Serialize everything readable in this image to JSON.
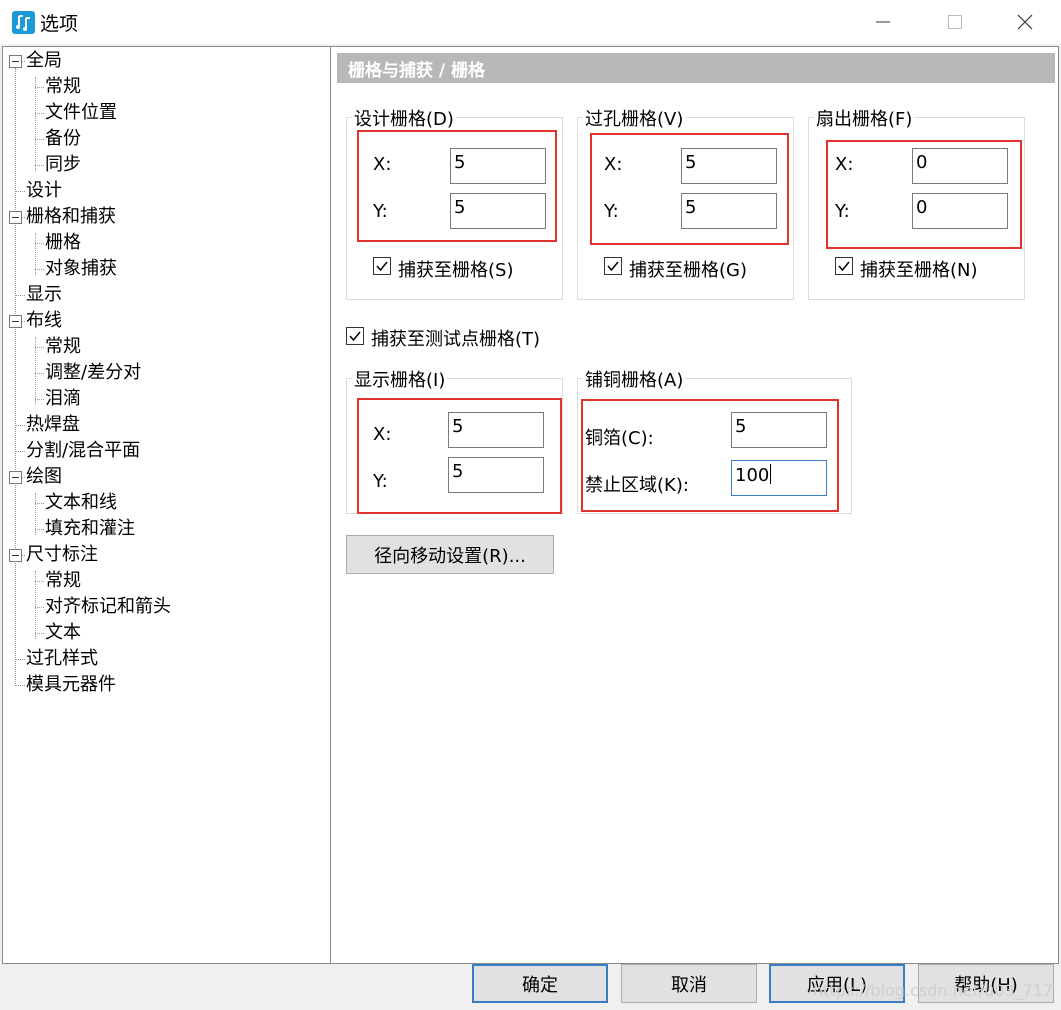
{
  "window": {
    "title": "选项",
    "app_icon": "app-logo-icon",
    "min_icon": "minimize-icon",
    "max_icon": "maximize-icon",
    "close_icon": "close-icon"
  },
  "tree": {
    "items": [
      {
        "label": "全局",
        "level": 0,
        "expanded": true
      },
      {
        "label": "常规",
        "level": 1
      },
      {
        "label": "文件位置",
        "level": 1
      },
      {
        "label": "备份",
        "level": 1
      },
      {
        "label": "同步",
        "level": 1
      },
      {
        "label": "设计",
        "level": 0
      },
      {
        "label": "栅格和捕获",
        "level": 0,
        "expanded": true
      },
      {
        "label": "栅格",
        "level": 1,
        "selected": true
      },
      {
        "label": "对象捕获",
        "level": 1
      },
      {
        "label": "显示",
        "level": 0
      },
      {
        "label": "布线",
        "level": 0,
        "expanded": true
      },
      {
        "label": "常规",
        "level": 1
      },
      {
        "label": "调整/差分对",
        "level": 1
      },
      {
        "label": "泪滴",
        "level": 1
      },
      {
        "label": "热焊盘",
        "level": 0
      },
      {
        "label": "分割/混合平面",
        "level": 0
      },
      {
        "label": "绘图",
        "level": 0,
        "expanded": true
      },
      {
        "label": "文本和线",
        "level": 1
      },
      {
        "label": "填充和灌注",
        "level": 1
      },
      {
        "label": "尺寸标注",
        "level": 0,
        "expanded": true
      },
      {
        "label": "常规",
        "level": 1
      },
      {
        "label": "对齐标记和箭头",
        "level": 1
      },
      {
        "label": "文本",
        "level": 1
      },
      {
        "label": "过孔样式",
        "level": 0
      },
      {
        "label": "模具元器件",
        "level": 0
      }
    ]
  },
  "panel": {
    "header": "栅格与捕获 / 栅格",
    "design_grid": {
      "title": "设计栅格(D)",
      "x_label": "X:",
      "x_value": "5",
      "y_label": "Y:",
      "y_value": "5",
      "snap_label": "捕获至栅格(S)",
      "snap_checked": true
    },
    "via_grid": {
      "title": "过孔栅格(V)",
      "x_label": "X:",
      "x_value": "5",
      "y_label": "Y:",
      "y_value": "5",
      "snap_label": "捕获至栅格(G)",
      "snap_checked": true
    },
    "fanout_grid": {
      "title": "扇出栅格(F)",
      "x_label": "X:",
      "x_value": "0",
      "y_label": "Y:",
      "y_value": "0",
      "snap_label": "捕获至栅格(N)",
      "snap_checked": true
    },
    "snap_testpoint": {
      "label": "捕获至测试点栅格(T)",
      "checked": true
    },
    "display_grid": {
      "title": "显示栅格(I)",
      "x_label": "X:",
      "x_value": "5",
      "y_label": "Y:",
      "y_value": "5"
    },
    "pour_grid": {
      "title": "铺铜栅格(A)",
      "copper_label": "铜箔(C):",
      "copper_value": "5",
      "keepout_label": "禁止区域(K):",
      "keepout_value": "100"
    },
    "radial_button": "径向移动设置(R)..."
  },
  "buttons": {
    "ok": "确定",
    "cancel": "取消",
    "apply": "应用(L)",
    "help": "帮助(H)"
  },
  "watermark": "https://blog.csdn.net/u03_717",
  "colors": {
    "highlight_red": "#e2322d",
    "header_gray": "#b8b8b8",
    "accent_blue": "#3a7cc8"
  }
}
